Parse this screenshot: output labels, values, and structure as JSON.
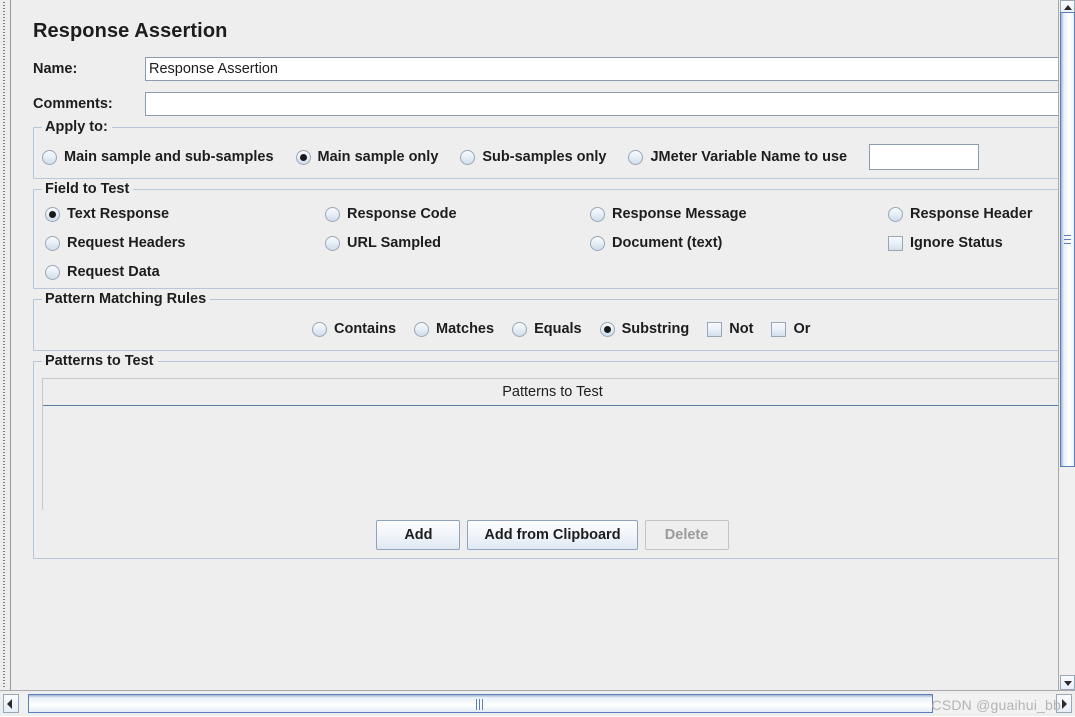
{
  "panel": {
    "title": "Response Assertion",
    "name_label": "Name:",
    "name_value": "Response Assertion",
    "comments_label": "Comments:",
    "comments_value": ""
  },
  "apply_to": {
    "group_title": "Apply to:",
    "options": [
      {
        "label": "Main sample and sub-samples",
        "type": "radio",
        "checked": false
      },
      {
        "label": "Main sample only",
        "type": "radio",
        "checked": true
      },
      {
        "label": "Sub-samples only",
        "type": "radio",
        "checked": false
      },
      {
        "label": "JMeter Variable Name to use",
        "type": "radio",
        "checked": false
      }
    ],
    "variable_name_value": ""
  },
  "field_to_test": {
    "group_title": "Field to Test",
    "options": [
      {
        "label": "Text Response",
        "type": "radio",
        "checked": true
      },
      {
        "label": "Response Code",
        "type": "radio",
        "checked": false
      },
      {
        "label": "Response Message",
        "type": "radio",
        "checked": false
      },
      {
        "label": "Response Header",
        "type": "radio",
        "checked": false
      },
      {
        "label": "Request Headers",
        "type": "radio",
        "checked": false
      },
      {
        "label": "URL Sampled",
        "type": "radio",
        "checked": false
      },
      {
        "label": "Document (text)",
        "type": "radio",
        "checked": false
      },
      {
        "label": "Ignore Status",
        "type": "checkbox",
        "checked": false
      },
      {
        "label": "Request Data",
        "type": "radio",
        "checked": false
      }
    ]
  },
  "pattern_matching_rules": {
    "group_title": "Pattern Matching Rules",
    "options": [
      {
        "label": "Contains",
        "type": "radio",
        "checked": false
      },
      {
        "label": "Matches",
        "type": "radio",
        "checked": false
      },
      {
        "label": "Equals",
        "type": "radio",
        "checked": false
      },
      {
        "label": "Substring",
        "type": "radio",
        "checked": true
      },
      {
        "label": "Not",
        "type": "checkbox",
        "checked": false
      },
      {
        "label": "Or",
        "type": "checkbox",
        "checked": false
      }
    ]
  },
  "patterns_to_test": {
    "group_title": "Patterns to Test",
    "column_header": "Patterns to Test",
    "rows": [],
    "buttons": [
      {
        "label": "Add",
        "enabled": true
      },
      {
        "label": "Add from Clipboard",
        "enabled": true
      },
      {
        "label": "Delete",
        "enabled": false
      }
    ]
  },
  "watermark": "CSDN @guaihui_bb",
  "colors": {
    "background": "#eeeeee",
    "group_border": "#b8c6d9",
    "input_border": "#8b9bb0",
    "scrollbar_thumb_border": "#5c7ebc",
    "text": "#1d1d1d",
    "disabled_text": "#9b9b9b"
  }
}
